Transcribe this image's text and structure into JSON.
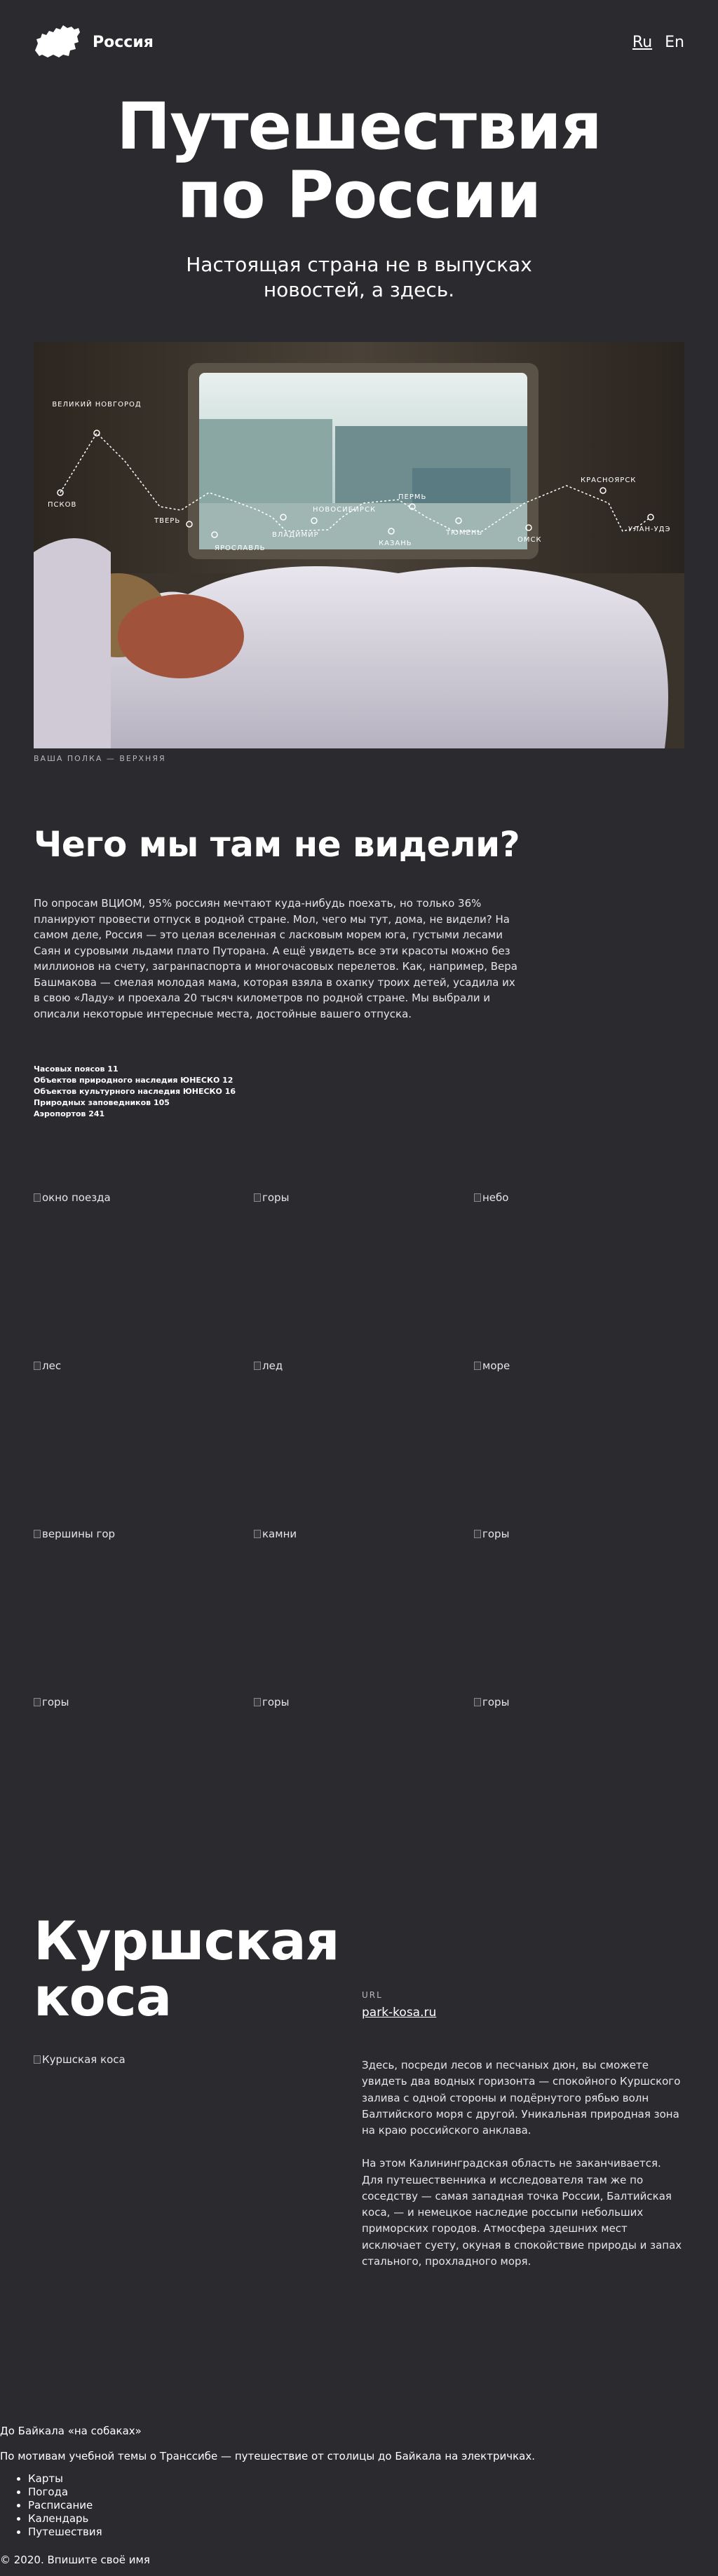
{
  "header": {
    "brand": "Россия",
    "lang": [
      "Ru",
      "En"
    ]
  },
  "hero": {
    "title_lines": [
      "Путешествия",
      "по России"
    ],
    "subtitle_lines": [
      "Настоящая страна не в выпусках",
      "новостей, а здесь."
    ]
  },
  "photo": {
    "route_labels": [
      "ПСКОВ",
      "ВЕЛИКИЙ НОВГОРОД",
      "ТВЕРЬ",
      "ЯРОСЛАВЛЬ",
      "ВЛАДИМИР",
      "НОВОСИБИРСК",
      "КАЗАНЬ",
      "ПЕРМЬ",
      "ТЮМЕНЬ",
      "ОМСК",
      "КРАСНОЯРСК",
      "УЛАН-УДЭ"
    ],
    "caption": "ВАША ПОЛКА — ВЕРХНЯЯ"
  },
  "section": {
    "heading": "Чего мы там не видели?",
    "intro": "По опросам ВЦИОМ, 95% россиян мечтают куда-нибудь поехать, но только 36% планируют провести отпуск в родной стране. Мол, чего мы тут, дома, не видели? На самом деле, Россия — это целая вселенная с ласковым морем юга, густыми лесами Саян и суровыми льдами плато Путорана. А ещё увидеть все эти красоты можно без миллионов на счету, загранпаспорта и многочасовых перелетов. Как, например, Вера Башмакова — смелая молодая мама, которая взяла в охапку троих детей, усадила их в свою «Ладу» и проехала 20 тысяч километров по родной стране. Мы выбрали и описали некоторые интересные места, достойные вашего отпуска.",
    "stats": [
      "Часовых поясов 11",
      "Объектов природного наследия ЮНЕСКО 12",
      "Объектов культурного наследия ЮНЕСКО 16",
      "Природных заповедников 105",
      "Аэропортов 241"
    ]
  },
  "gallery": [
    "окно поезда",
    "горы",
    "небо",
    "лес",
    "лед",
    "море",
    "вершины гор",
    "камни",
    "горы",
    "горы",
    "горы",
    "горы"
  ],
  "kosa": {
    "title_lines": [
      "Куршская",
      "коса"
    ],
    "image_alt": "Куршская коса",
    "url_label": "URL",
    "url": "park-kosa.ru",
    "paragraphs": [
      "Здесь, посреди лесов и песчаных дюн, вы сможете увидеть два водных горизонта — спокойного Куршского залива с одной стороны и подёрнутого рябью волн Балтийского моря с другой. Уникальная природная зона на краю российского анклава.",
      "На этом Калининградская область не заканчивается. Для путешественника и исследователя там же по соседству — самая западная точка России, Балтийская коса, — и немецкое наследие россыпи небольших приморских городов. Атмосфера здешних мест исключает суету, окуная в спокойствие природы и запах стального, прохладного моря."
    ]
  },
  "footer": {
    "title": "До Байкала «на собаках»",
    "description": "По мотивам учебной темы о Транссибе — путешествие от столицы до Байкала на электричках.",
    "links": [
      "Карты",
      "Погода",
      "Расписание",
      "Календарь",
      "Путешествия"
    ],
    "copyright": "© 2020. Впишите своё имя"
  }
}
